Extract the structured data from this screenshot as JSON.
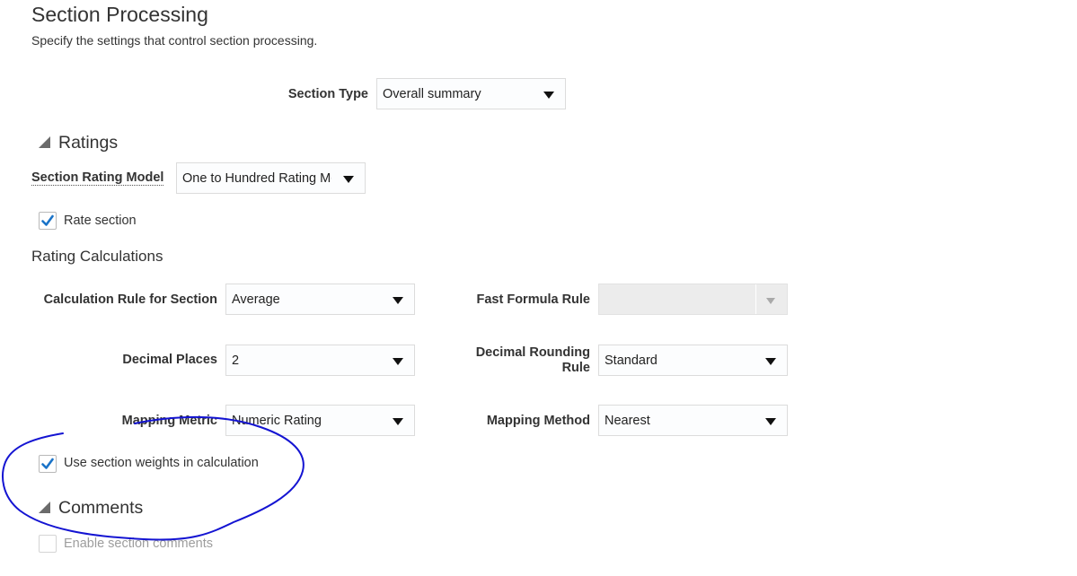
{
  "page": {
    "title": "Section Processing",
    "subtitle": "Specify the settings that control section processing."
  },
  "section_type": {
    "label": "Section Type",
    "value": "Overall summary"
  },
  "ratings": {
    "header": "Ratings",
    "model_label": "Section Rating Model",
    "model_value": "One to Hundred Rating Model",
    "rate_section_label": "Rate section",
    "rate_section_checked": true
  },
  "calculations": {
    "header": "Rating Calculations",
    "calc_rule_label": "Calculation Rule for Section",
    "calc_rule_value": "Average",
    "fast_formula_label": "Fast Formula Rule",
    "fast_formula_value": "",
    "decimal_places_label": "Decimal Places",
    "decimal_places_value": "2",
    "rounding_label_line1": "Decimal Rounding",
    "rounding_label_line2": "Rule",
    "rounding_value": "Standard",
    "mapping_metric_label": "Mapping Metric",
    "mapping_metric_value": "Numeric Rating",
    "mapping_method_label": "Mapping Method",
    "mapping_method_value": "Nearest",
    "weights_label": "Use section weights in calculation",
    "weights_checked": true
  },
  "comments": {
    "header": "Comments",
    "enable_label": "Enable section comments",
    "enable_checked": false
  },
  "colors": {
    "checkmark": "#1a73c8",
    "annotation_ink": "#1414d2"
  }
}
